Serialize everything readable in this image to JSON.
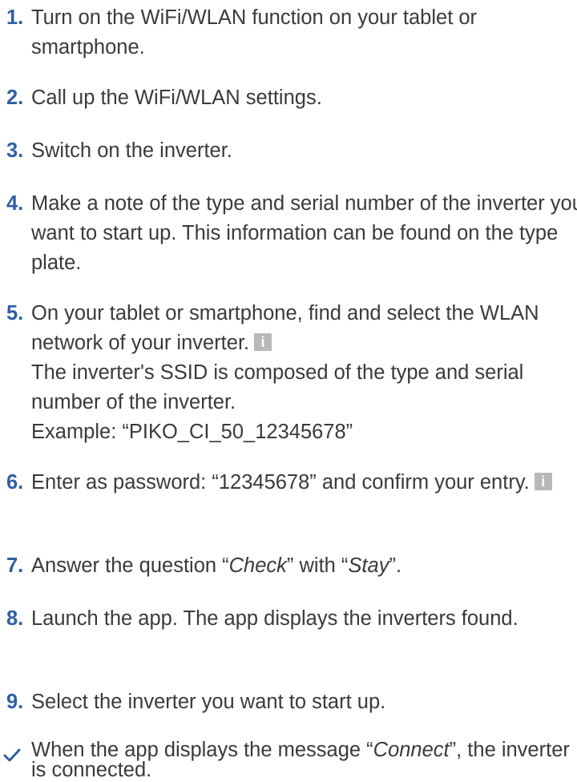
{
  "colors": {
    "number": "#2f5fa3",
    "text": "#3a3a3a",
    "info_icon": "#b8b8b8"
  },
  "steps": [
    {
      "num": "1.",
      "text": "Turn on the WiFi/WLAN function on your tablet or smartphone."
    },
    {
      "num": "2.",
      "text": "Call up the WiFi/WLAN settings."
    },
    {
      "num": "3.",
      "text": "Switch on the inverter."
    },
    {
      "num": "4.",
      "text": "Make a note of the type and serial number of the inverter you want to start up. This information can be found on the type plate."
    },
    {
      "num": "5.",
      "text": "On your tablet or smartphone, find and select the WLAN network of your inverter.",
      "extra1": "The inverter's SSID is composed of the type and serial number of the inverter.",
      "extra2": "Example: “PIKO_CI_50_12345678”"
    },
    {
      "num": "6.",
      "text": "Enter as password: “12345678” and confirm your entry."
    },
    {
      "num": "7.",
      "pre": "Answer the question “",
      "em1": "Check",
      "mid": "” with “",
      "em2": "Stay",
      "post": "”."
    },
    {
      "num": "8.",
      "text": "Launch the app. The app displays the inverters found."
    },
    {
      "num": "9.",
      "text": "Select the inverter you want to start up."
    }
  ],
  "result": {
    "pre": "When the app displays the message “",
    "em": "Connect",
    "post": "”, the inverter is connected."
  },
  "icons": {
    "info": "info-icon",
    "check": "checkmark-icon",
    "info_glyph": "i"
  }
}
